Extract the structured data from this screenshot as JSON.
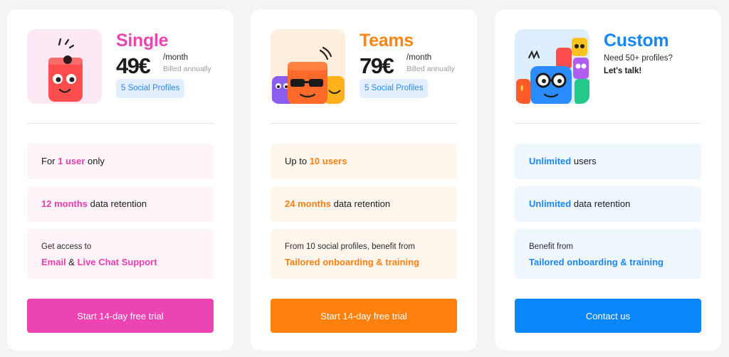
{
  "plans": {
    "single": {
      "name": "Single",
      "price": "49€",
      "period": "/month",
      "billing": "Billed annually",
      "profiles_badge": "5 Social Profiles",
      "feature_users": {
        "prefix": "For ",
        "highlight": "1 user",
        "suffix": " only"
      },
      "feature_retention": {
        "highlight": "12 months",
        "suffix": " data retention"
      },
      "feature_support": {
        "intro": "Get access to",
        "highlight_1": "Email",
        "joiner": " & ",
        "highlight_2": "Live Chat Support"
      },
      "cta": "Start 14-day free trial",
      "avatar_icon": "single-monster-icon"
    },
    "teams": {
      "name": "Teams",
      "price": "79€",
      "period": "/month",
      "billing": "Billed annually",
      "profiles_badge": "5 Social Profiles",
      "feature_users": {
        "prefix": "Up to ",
        "highlight": "10 users",
        "suffix": ""
      },
      "feature_retention": {
        "highlight": "24 months",
        "suffix": " data retention"
      },
      "feature_support": {
        "intro": "From 10 social profiles, benefit from",
        "highlight": "Tailored onboarding & training"
      },
      "cta": "Start 14-day free trial",
      "avatar_icon": "teams-monsters-icon"
    },
    "custom": {
      "name": "Custom",
      "subtitle": "Need 50+ profiles?",
      "cta_text": "Let's talk!",
      "feature_users": {
        "highlight": "Unlimited",
        "suffix": " users"
      },
      "feature_retention": {
        "highlight": "Unlimited",
        "suffix": " data retention"
      },
      "feature_support": {
        "intro": "Benefit from",
        "highlight": "Tailored onboarding & training"
      },
      "cta": "Contact us",
      "avatar_icon": "custom-monsters-icon"
    }
  },
  "colors": {
    "single_accent": "#ec44b3",
    "teams_accent": "#ff800d",
    "custom_accent": "#0a86fb"
  }
}
